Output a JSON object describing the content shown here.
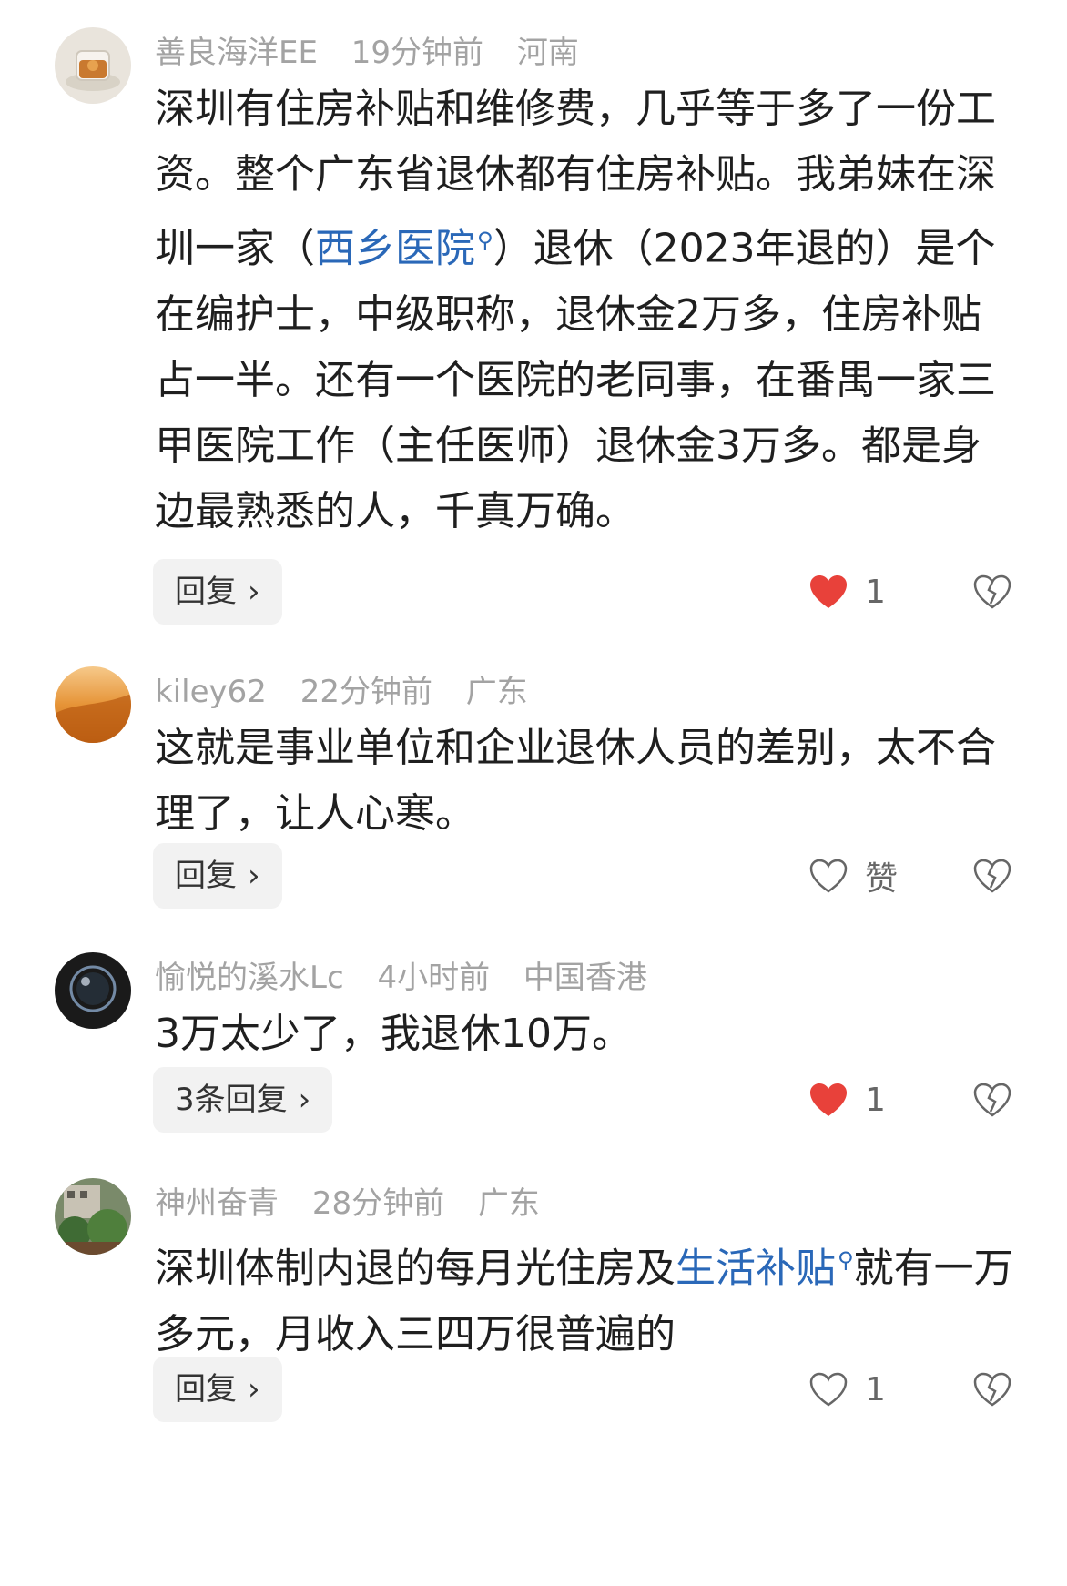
{
  "comments": [
    {
      "username": "善良海洋EE",
      "time": "19分钟前",
      "location": "河南",
      "text_part1": "深圳有住房补贴和维修费，几乎等于多了一份工资。整个广东省退休都有住房补贴。我弟妹在深圳一家（",
      "link": "西乡医院",
      "text_part2": "）退休（2023年退的）是个在编护士，中级职称，退休金2万多，住房补贴占一半。还有一个医院的老同事，在番禺一家三甲医院工作（主任医师）退休金3万多。都是身边最熟悉的人，千真万确。",
      "reply_label": "回复",
      "like_count": "1",
      "liked": true
    },
    {
      "username": "kiley62",
      "time": "22分钟前",
      "location": "广东",
      "text": "这就是事业单位和企业退休人员的差别，太不合理了，让人心寒。",
      "reply_label": "回复",
      "like_label": "赞",
      "liked": false
    },
    {
      "username": "愉悦的溪水Lc",
      "time": "4小时前",
      "location": "中国香港",
      "text": "3万太少了，我退休10万。",
      "reply_label": "3条回复",
      "like_count": "1",
      "liked": true
    },
    {
      "username": "神州奋青",
      "time": "28分钟前",
      "location": "广东",
      "text_part1": "深圳体制内退的每月光住房及",
      "link": "生活补贴",
      "text_part2": "就有一万多元，月收入三四万很普遍的",
      "reply_label": "回复",
      "like_count": "1",
      "liked": false
    }
  ],
  "icons": {
    "chevron": "›",
    "search": "⚲"
  },
  "colors": {
    "like_red": "#e8413a",
    "link_blue": "#2a68b8",
    "meta_gray": "#a3a3a3"
  }
}
